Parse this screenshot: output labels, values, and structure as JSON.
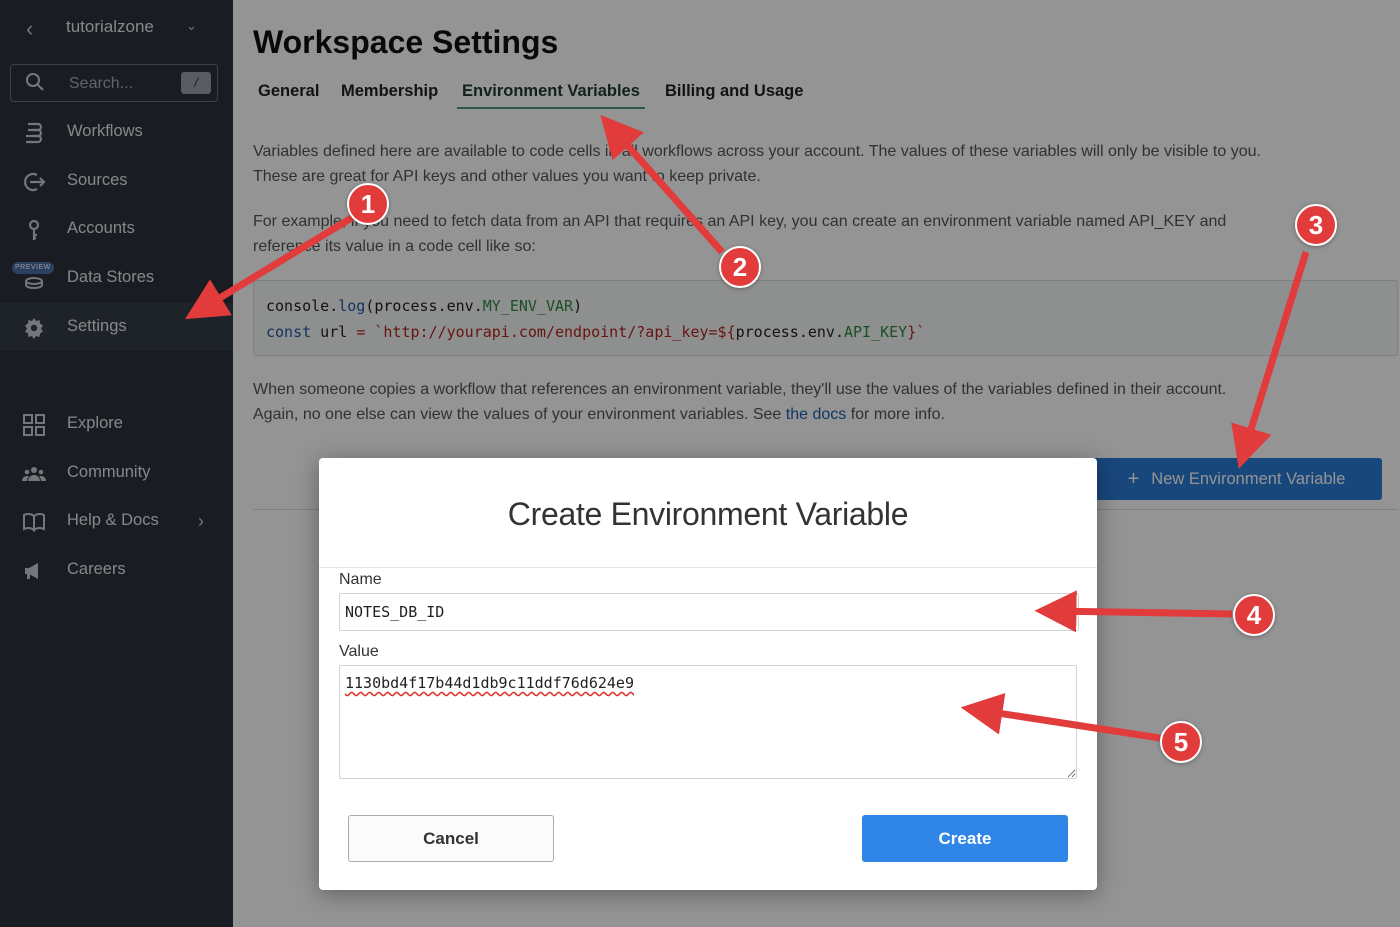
{
  "workspace": {
    "name": "tutorialzone"
  },
  "search": {
    "placeholder": "Search...",
    "shortcut": "/"
  },
  "sidebar": {
    "items": [
      {
        "label": "Workflows",
        "icon": "workflows-icon"
      },
      {
        "label": "Sources",
        "icon": "sources-icon"
      },
      {
        "label": "Accounts",
        "icon": "key-icon"
      },
      {
        "label": "Data Stores",
        "icon": "database-icon",
        "badge": "PREVIEW"
      },
      {
        "label": "Settings",
        "icon": "gear-icon",
        "active": true
      },
      {
        "label": "Explore",
        "icon": "grid-icon"
      },
      {
        "label": "Community",
        "icon": "people-icon"
      },
      {
        "label": "Help & Docs",
        "icon": "book-icon"
      },
      {
        "label": "Careers",
        "icon": "megaphone-icon"
      }
    ]
  },
  "page": {
    "title": "Workspace Settings",
    "tabs": [
      {
        "label": "General"
      },
      {
        "label": "Membership"
      },
      {
        "label": "Environment Variables",
        "active": true
      },
      {
        "label": "Billing and Usage"
      }
    ],
    "intro_line1": "Variables defined here are available to code cells in all workflows across your account. The values of these variables will only be visible to you.",
    "intro_line2": "These are great for API keys and other values you want to keep private.",
    "example_line1": "For example, if you need to fetch data from an API that requires an API key, you can create an environment variable named API_KEY and",
    "example_line2": "reference its value in a code cell like so:",
    "code": {
      "line1": {
        "obj": "console",
        "dot": ".",
        "fn": "log",
        "open": "(",
        "arg_obj": "process",
        "arg_dot1": ".",
        "arg_mid": "env",
        "arg_dot2": ".",
        "arg_prop": "MY_ENV_VAR",
        "close": ")"
      },
      "line2": {
        "kw": "const",
        "name": " url ",
        "eq": "=",
        "sp": " ",
        "tpl_start": "`http://yourapi.com/endpoint/?api_key=",
        "interp_open": "${",
        "interp_obj": "process",
        "interp_dot1": ".",
        "interp_mid": "env",
        "interp_dot2": ".",
        "interp_prop": "API_KEY",
        "interp_close": "}",
        "tpl_end": "`"
      }
    },
    "copies_line1": "When someone copies a workflow that references an environment variable, they'll use the values of the variables defined in their account.",
    "copies_line2_pre": "Again, no one else can view the values of your environment variables. See ",
    "docs_link": "the docs",
    "copies_line2_post": " for more info.",
    "new_var_button": "New Environment Variable",
    "new_var_button_icon": "+"
  },
  "modal": {
    "title": "Create Environment Variable",
    "name_label": "Name",
    "name_value": "NOTES_DB_ID",
    "value_label": "Value",
    "value_value": "1130bd4f17b44d1db9c11ddf76d624e9",
    "cancel_label": "Cancel",
    "create_label": "Create"
  },
  "annotations": {
    "badges": [
      "1",
      "2",
      "3",
      "4",
      "5"
    ],
    "color": "#e23b3b"
  },
  "colors": {
    "sidebar_bg": "#2b313b",
    "primary_button": "#2f86e6",
    "tab_underline": "#4c9a76",
    "annotation_red": "#e23b3b"
  }
}
